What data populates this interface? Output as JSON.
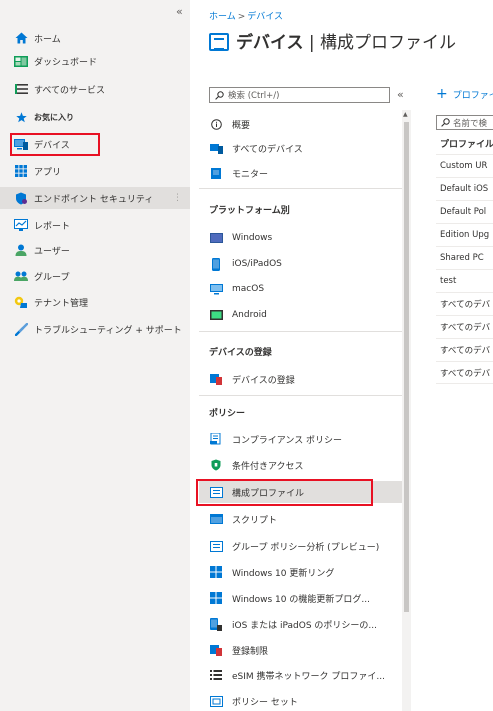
{
  "portal_nav": {
    "collapse_glyph": "«",
    "items": [
      {
        "label": "ホーム",
        "icon": "home-icon"
      },
      {
        "label": "ダッシュボード",
        "icon": "dashboard-icon"
      },
      {
        "label": "すべてのサービス",
        "icon": "list-icon"
      },
      {
        "label": "お気に入り",
        "icon": "star-icon"
      },
      {
        "label": "デバイス",
        "icon": "devices-icon"
      },
      {
        "label": "アプリ",
        "icon": "apps-grid-icon"
      },
      {
        "label": "エンドポイント セキュリティ",
        "icon": "shield-icon"
      },
      {
        "label": "レポート",
        "icon": "reports-icon"
      },
      {
        "label": "ユーザー",
        "icon": "user-icon"
      },
      {
        "label": "グループ",
        "icon": "group-icon"
      },
      {
        "label": "テナント管理",
        "icon": "tenant-icon"
      },
      {
        "label": "トラブルシューティング + サポート",
        "icon": "wrench-icon"
      }
    ],
    "more_glyph": "⋮"
  },
  "header": {
    "breadcrumb": [
      "ホーム",
      "デバイス"
    ],
    "breadcrumb_sep": ">",
    "title_bold": "デバイス",
    "title_rest": " | 構成プロファイル"
  },
  "menu": {
    "search_placeholder": "検索 (Ctrl+/)",
    "collapse_glyph": "«",
    "top_items": [
      {
        "label": "概要",
        "icon": "info-icon"
      },
      {
        "label": "すべてのデバイス",
        "icon": "all-devices-icon"
      },
      {
        "label": "モニター",
        "icon": "monitor-icon"
      }
    ],
    "platform_header": "プラットフォーム別",
    "platform_items": [
      {
        "label": "Windows",
        "icon": "windows-icon"
      },
      {
        "label": "iOS/iPadOS",
        "icon": "phone-icon"
      },
      {
        "label": "macOS",
        "icon": "mac-icon"
      },
      {
        "label": "Android",
        "icon": "android-icon"
      }
    ],
    "enroll_header": "デバイスの登録",
    "enroll_items": [
      {
        "label": "デバイスの登録",
        "icon": "enroll-icon"
      }
    ],
    "policy_header": "ポリシー",
    "policy_items": [
      {
        "label": "コンプライアンス ポリシー",
        "icon": "compliance-icon"
      },
      {
        "label": "条件付きアクセス",
        "icon": "conditional-access-icon"
      },
      {
        "label": "構成プロファイル",
        "icon": "config-profile-icon"
      },
      {
        "label": "スクリプト",
        "icon": "script-icon"
      },
      {
        "label": "グループ ポリシー分析 (プレビュー)",
        "icon": "group-policy-icon"
      },
      {
        "label": "Windows 10 更新リング",
        "icon": "windows-icon"
      },
      {
        "label": "Windows 10 の機能更新プログ...",
        "icon": "windows-icon"
      },
      {
        "label": "iOS または iPadOS のポリシーの...",
        "icon": "ios-policy-icon"
      },
      {
        "label": "登録制限",
        "icon": "restriction-icon"
      },
      {
        "label": "eSIM 携帯ネットワーク プロファイ...",
        "icon": "esim-icon"
      },
      {
        "label": "ポリシー セット",
        "icon": "policy-set-icon"
      }
    ]
  },
  "right_pane": {
    "add_label": "プロファイ",
    "filter_placeholder": "名前で検",
    "column_header": "プロファイル名",
    "rows": [
      "Custom UR",
      "Default iOS",
      "Default Pol",
      "Edition Upg",
      "Shared PC",
      "test",
      "すべてのデバ",
      "すべてのデバ",
      "すべてのデバ",
      "すべてのデバ"
    ]
  },
  "colors": {
    "accent": "#0078d4",
    "highlight_border": "#e81123",
    "nav_bg": "#f3f2f1",
    "selected_bg": "#e1dfdd"
  }
}
